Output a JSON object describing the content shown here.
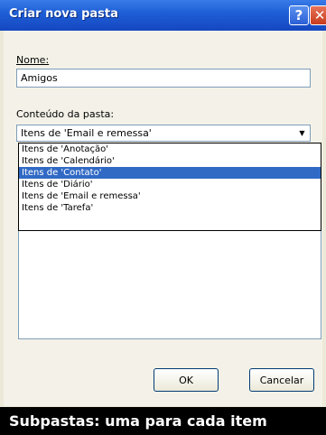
{
  "window": {
    "title": "Criar nova pasta",
    "help_glyph": "?",
    "close_glyph": "✕"
  },
  "form": {
    "name_label": "Nome:",
    "name_value": "Amigos",
    "content_label": "Conteúdo da pasta:",
    "content_selected": "Itens de 'Email e remessa'",
    "options": [
      "Itens de 'Anotação'",
      "Itens de 'Calendário'",
      "Itens de 'Contato'",
      "Itens de 'Diário'",
      "Itens de 'Email e remessa'",
      "Itens de 'Tarefa'"
    ],
    "highlighted_option": 2
  },
  "buttons": {
    "ok": "OK",
    "cancel": "Cancelar"
  },
  "caption": "Subpastas: uma para cada item",
  "colors": {
    "titlebar": "#1f5fd6",
    "selection": "#316ac5",
    "caption_bg": "#000000"
  }
}
